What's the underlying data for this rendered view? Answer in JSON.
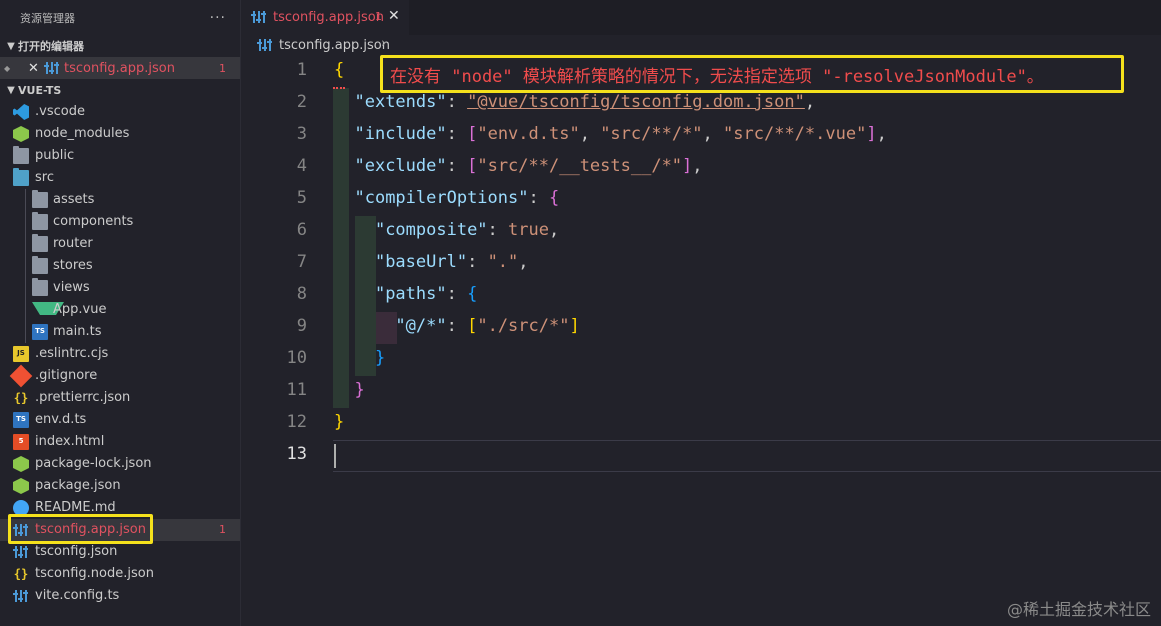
{
  "explorer": {
    "title": "资源管理器",
    "more": "···",
    "open_editors": {
      "label": "打开的编辑器",
      "items": [
        {
          "name": "tsconfig.app.json",
          "errors": "1"
        }
      ]
    },
    "project": {
      "label": "VUE-TS",
      "tree": [
        {
          "name": ".vscode",
          "icon": "vscode-folder-icon",
          "depth": 0
        },
        {
          "name": "node_modules",
          "icon": "node-folder-icon",
          "depth": 0
        },
        {
          "name": "public",
          "icon": "folder-icon",
          "depth": 0
        },
        {
          "name": "src",
          "icon": "folder-open-icon",
          "depth": 0
        },
        {
          "name": "assets",
          "icon": "folder-icon",
          "depth": 1
        },
        {
          "name": "components",
          "icon": "folder-icon",
          "depth": 1
        },
        {
          "name": "router",
          "icon": "folder-icon",
          "depth": 1
        },
        {
          "name": "stores",
          "icon": "folder-icon",
          "depth": 1
        },
        {
          "name": "views",
          "icon": "folder-icon",
          "depth": 1
        },
        {
          "name": "App.vue",
          "icon": "vue-icon",
          "depth": 1
        },
        {
          "name": "main.ts",
          "icon": "ts-icon",
          "depth": 1
        },
        {
          "name": ".eslintrc.cjs",
          "icon": "js-icon",
          "depth": 0
        },
        {
          "name": ".gitignore",
          "icon": "git-icon",
          "depth": 0
        },
        {
          "name": ".prettierrc.json",
          "icon": "json-icon",
          "depth": 0
        },
        {
          "name": "env.d.ts",
          "icon": "ts-icon",
          "depth": 0
        },
        {
          "name": "index.html",
          "icon": "html-icon",
          "depth": 0
        },
        {
          "name": "package-lock.json",
          "icon": "node-icon",
          "depth": 0
        },
        {
          "name": "package.json",
          "icon": "node-icon",
          "depth": 0
        },
        {
          "name": "README.md",
          "icon": "info-icon",
          "depth": 0
        },
        {
          "name": "tsconfig.app.json",
          "icon": "tsconfig-icon",
          "depth": 0,
          "active": true,
          "errors": "1"
        },
        {
          "name": "tsconfig.json",
          "icon": "tsconfig-icon",
          "depth": 0
        },
        {
          "name": "tsconfig.node.json",
          "icon": "json-icon",
          "depth": 0
        },
        {
          "name": "vite.config.ts",
          "icon": "tsconfig-icon",
          "depth": 0
        }
      ]
    }
  },
  "editor": {
    "tab": {
      "name": "tsconfig.app.json",
      "errors": "1",
      "close": "✕"
    },
    "breadcrumb": {
      "file": "tsconfig.app.json",
      "sep": "›"
    },
    "error_message": "在没有 \"node\" 模块解析策略的情况下，无法指定选项 \"-resolveJsonModule\"。",
    "line_numbers": [
      "1",
      "2",
      "3",
      "4",
      "5",
      "6",
      "7",
      "8",
      "9",
      "10",
      "11",
      "12",
      "13"
    ],
    "current_line": "13",
    "code": {
      "extends_key": "\"extends\"",
      "extends_val": "\"@vue/tsconfig/tsconfig.dom.json\"",
      "include_key": "\"include\"",
      "include_vals": [
        "\"env.d.ts\"",
        "\"src/**/*\"",
        "\"src/**/*.vue\""
      ],
      "exclude_key": "\"exclude\"",
      "exclude_vals": [
        "\"src/**/__tests__/*\""
      ],
      "compiler_key": "\"compilerOptions\"",
      "composite_key": "\"composite\"",
      "composite_val": "true",
      "baseurl_key": "\"baseUrl\"",
      "baseurl_val": "\".\"",
      "paths_key": "\"paths\"",
      "alias_key": "\"@/*\"",
      "alias_val": "\"./src/*\""
    }
  },
  "watermark": "@稀土掘金技术社区",
  "colors": {
    "error": "#e05260",
    "highlight": "#f5e11c",
    "key": "#9cdcfe",
    "string": "#ce9178"
  }
}
